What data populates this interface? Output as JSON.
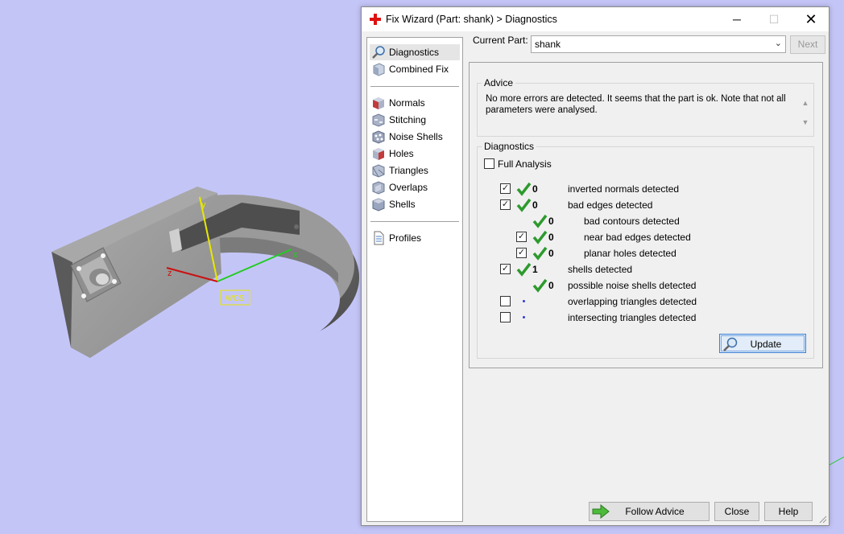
{
  "window": {
    "title": "Fix Wizard (Part: shank) > Diagnostics",
    "minimize": "─",
    "maximize": "☐",
    "close": "✕"
  },
  "viewport": {
    "wcs_label": "WCS",
    "axis_x": "x",
    "axis_y": "y",
    "axis_z": "z",
    "background": "#c4c5f7"
  },
  "nav": {
    "items": [
      {
        "label": "Diagnostics",
        "icon": "magnifier-icon",
        "selected": true
      },
      {
        "label": "Combined Fix",
        "icon": "combined-fix-icon"
      },
      {
        "label": "Normals",
        "icon": "normals-icon"
      },
      {
        "label": "Stitching",
        "icon": "stitching-icon"
      },
      {
        "label": "Noise Shells",
        "icon": "noise-shells-icon"
      },
      {
        "label": "Holes",
        "icon": "holes-icon"
      },
      {
        "label": "Triangles",
        "icon": "triangles-icon"
      },
      {
        "label": "Overlaps",
        "icon": "overlaps-icon"
      },
      {
        "label": "Shells",
        "icon": "shells-icon"
      },
      {
        "label": "Profiles",
        "icon": "profiles-icon"
      }
    ]
  },
  "current_part": {
    "label": "Current Part:",
    "value": "shank",
    "next_label": "Next"
  },
  "advice": {
    "title": "Advice",
    "text": "No more errors are detected. It seems that the part is ok. Note that not all parameters were analysed."
  },
  "diagnostics": {
    "title": "Diagnostics",
    "full_analysis": {
      "label": "Full Analysis",
      "checked": false
    },
    "rows": [
      {
        "checked": true,
        "status": "ok",
        "count": "0",
        "label": "inverted normals detected"
      },
      {
        "checked": true,
        "status": "ok",
        "count": "0",
        "label": "bad edges detected"
      },
      {
        "status": "ok",
        "count": "0",
        "label": "bad contours detected"
      },
      {
        "checked": true,
        "status": "ok",
        "count": "0",
        "label": "near bad edges detected"
      },
      {
        "checked": true,
        "status": "ok",
        "count": "0",
        "label": "planar holes detected"
      },
      {
        "checked": true,
        "status": "ok",
        "count": "1",
        "label": "shells detected"
      },
      {
        "status": "ok",
        "count": "0",
        "label": "possible noise shells detected"
      },
      {
        "checked": false,
        "status": "pending",
        "label": "overlapping triangles detected"
      },
      {
        "checked": false,
        "status": "pending",
        "label": "intersecting triangles detected"
      }
    ],
    "update_label": "Update"
  },
  "buttons": {
    "follow_advice": "Follow Advice",
    "close": "Close",
    "help": "Help"
  },
  "colors": {
    "check_green": "#2e9a2e",
    "dot_blue": "#2a3fd0",
    "accent": "#3c7fd6"
  }
}
